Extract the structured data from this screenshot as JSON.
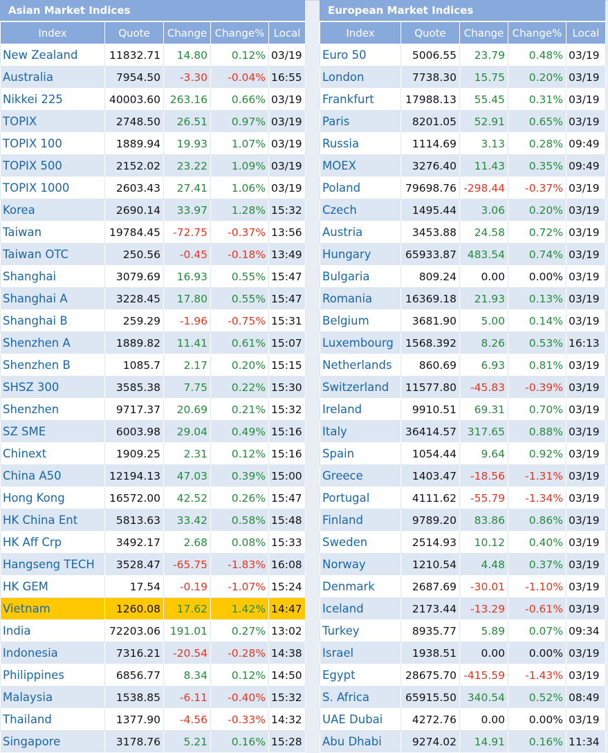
{
  "colors": {
    "header": "#87a9dc",
    "row_alt": "#dde7f3",
    "highlight": "#ffc800",
    "up": "#268a3a",
    "down": "#e8341f",
    "link": "#1a66a8"
  },
  "asia": {
    "title": "Asian Market Indices",
    "columns": [
      "Index",
      "Quote",
      "Change",
      "Change%",
      "Local"
    ],
    "highlight_row": "Vietnam",
    "rows": [
      [
        "New Zealand",
        "11832.71",
        "14.80",
        "0.12%",
        "03/19"
      ],
      [
        "Australia",
        "7954.50",
        "-3.30",
        "-0.04%",
        "16:55"
      ],
      [
        "Nikkei 225",
        "40003.60",
        "263.16",
        "0.66%",
        "03/19"
      ],
      [
        "TOPIX",
        "2748.50",
        "26.51",
        "0.97%",
        "03/19"
      ],
      [
        "TOPIX 100",
        "1889.94",
        "19.93",
        "1.07%",
        "03/19"
      ],
      [
        "TOPIX 500",
        "2152.02",
        "23.22",
        "1.09%",
        "03/19"
      ],
      [
        "TOPIX 1000",
        "2603.43",
        "27.41",
        "1.06%",
        "03/19"
      ],
      [
        "Korea",
        "2690.14",
        "33.97",
        "1.28%",
        "15:32"
      ],
      [
        "Taiwan",
        "19784.45",
        "-72.75",
        "-0.37%",
        "13:56"
      ],
      [
        "Taiwan OTC",
        "250.56",
        "-0.45",
        "-0.18%",
        "13:49"
      ],
      [
        "Shanghai",
        "3079.69",
        "16.93",
        "0.55%",
        "15:47"
      ],
      [
        "Shanghai A",
        "3228.45",
        "17.80",
        "0.55%",
        "15:47"
      ],
      [
        "Shanghai B",
        "259.29",
        "-1.96",
        "-0.75%",
        "15:31"
      ],
      [
        "Shenzhen A",
        "1889.82",
        "11.41",
        "0.61%",
        "15:07"
      ],
      [
        "Shenzhen B",
        "1085.7",
        "2.17",
        "0.20%",
        "15:15"
      ],
      [
        "SHSZ 300",
        "3585.38",
        "7.75",
        "0.22%",
        "15:30"
      ],
      [
        "Shenzhen",
        "9717.37",
        "20.69",
        "0.21%",
        "15:32"
      ],
      [
        "SZ SME",
        "6003.98",
        "29.04",
        "0.49%",
        "15:16"
      ],
      [
        "Chinext",
        "1909.25",
        "2.31",
        "0.12%",
        "15:16"
      ],
      [
        "China A50",
        "12194.13",
        "47.03",
        "0.39%",
        "15:00"
      ],
      [
        "Hong Kong",
        "16572.00",
        "42.52",
        "0.26%",
        "15:47"
      ],
      [
        "HK China Ent",
        "5813.63",
        "33.42",
        "0.58%",
        "15:48"
      ],
      [
        "HK Aff Crp",
        "3492.17",
        "2.68",
        "0.08%",
        "15:33"
      ],
      [
        "Hangseng TECH",
        "3528.47",
        "-65.75",
        "-1.83%",
        "16:08"
      ],
      [
        "HK GEM",
        "17.54",
        "-0.19",
        "-1.07%",
        "15:24"
      ],
      [
        "Vietnam",
        "1260.08",
        "17.62",
        "1.42%",
        "14:47"
      ],
      [
        "India",
        "72203.06",
        "191.01",
        "0.27%",
        "13:02"
      ],
      [
        "Indonesia",
        "7316.21",
        "-20.54",
        "-0.28%",
        "14:38"
      ],
      [
        "Philippines",
        "6856.77",
        "8.34",
        "0.12%",
        "14:50"
      ],
      [
        "Malaysia",
        "1538.85",
        "-6.11",
        "-0.40%",
        "15:32"
      ],
      [
        "Thailand",
        "1377.90",
        "-4.56",
        "-0.33%",
        "14:32"
      ],
      [
        "Singapore",
        "3178.76",
        "5.21",
        "0.16%",
        "15:28"
      ]
    ]
  },
  "europe": {
    "title": "European Market Indices",
    "columns": [
      "Index",
      "Quote",
      "Change",
      "Change%",
      "Local"
    ],
    "highlight_row": "",
    "rows": [
      [
        "Euro 50",
        "5006.55",
        "23.79",
        "0.48%",
        "03/19"
      ],
      [
        "London",
        "7738.30",
        "15.75",
        "0.20%",
        "03/19"
      ],
      [
        "Frankfurt",
        "17988.13",
        "55.45",
        "0.31%",
        "03/19"
      ],
      [
        "Paris",
        "8201.05",
        "52.91",
        "0.65%",
        "03/19"
      ],
      [
        "Russia",
        "1114.69",
        "3.13",
        "0.28%",
        "09:49"
      ],
      [
        "MOEX",
        "3276.40",
        "11.43",
        "0.35%",
        "09:49"
      ],
      [
        "Poland",
        "79698.76",
        "-298.44",
        "-0.37%",
        "03/19"
      ],
      [
        "Czech",
        "1495.44",
        "3.06",
        "0.20%",
        "03/19"
      ],
      [
        "Austria",
        "3453.88",
        "24.58",
        "0.72%",
        "03/19"
      ],
      [
        "Hungary",
        "65933.87",
        "483.54",
        "0.74%",
        "03/19"
      ],
      [
        "Bulgaria",
        "809.24",
        "0.00",
        "0.00%",
        "03/19"
      ],
      [
        "Romania",
        "16369.18",
        "21.93",
        "0.13%",
        "03/19"
      ],
      [
        "Belgium",
        "3681.90",
        "5.00",
        "0.14%",
        "03/19"
      ],
      [
        "Luxembourg",
        "1568.392",
        "8.26",
        "0.53%",
        "16:13"
      ],
      [
        "Netherlands",
        "860.69",
        "6.93",
        "0.81%",
        "03/19"
      ],
      [
        "Switzerland",
        "11577.80",
        "-45.83",
        "-0.39%",
        "03/19"
      ],
      [
        "Ireland",
        "9910.51",
        "69.31",
        "0.70%",
        "03/19"
      ],
      [
        "Italy",
        "36414.57",
        "317.65",
        "0.88%",
        "03/19"
      ],
      [
        "Spain",
        "1054.44",
        "9.64",
        "0.92%",
        "03/19"
      ],
      [
        "Greece",
        "1403.47",
        "-18.56",
        "-1.31%",
        "03/19"
      ],
      [
        "Portugal",
        "4111.62",
        "-55.79",
        "-1.34%",
        "03/19"
      ],
      [
        "Finland",
        "9789.20",
        "83.86",
        "0.86%",
        "03/19"
      ],
      [
        "Sweden",
        "2514.93",
        "10.12",
        "0.40%",
        "03/19"
      ],
      [
        "Norway",
        "1210.54",
        "4.48",
        "0.37%",
        "03/19"
      ],
      [
        "Denmark",
        "2687.69",
        "-30.01",
        "-1.10%",
        "03/19"
      ],
      [
        "Iceland",
        "2173.44",
        "-13.29",
        "-0.61%",
        "03/19"
      ],
      [
        "Turkey",
        "8935.77",
        "5.89",
        "0.07%",
        "09:34"
      ],
      [
        "Israel",
        "1938.51",
        "0.00",
        "0.00%",
        "03/19"
      ],
      [
        "Egypt",
        "28675.70",
        "-415.59",
        "-1.43%",
        "03/19"
      ],
      [
        "S. Africa",
        "65915.50",
        "340.54",
        "0.52%",
        "08:49"
      ],
      [
        "UAE Dubai",
        "4272.76",
        "0.00",
        "0.00%",
        "03/19"
      ],
      [
        "Abu Dhabi",
        "9274.02",
        "14.91",
        "0.16%",
        "11:34"
      ]
    ]
  }
}
